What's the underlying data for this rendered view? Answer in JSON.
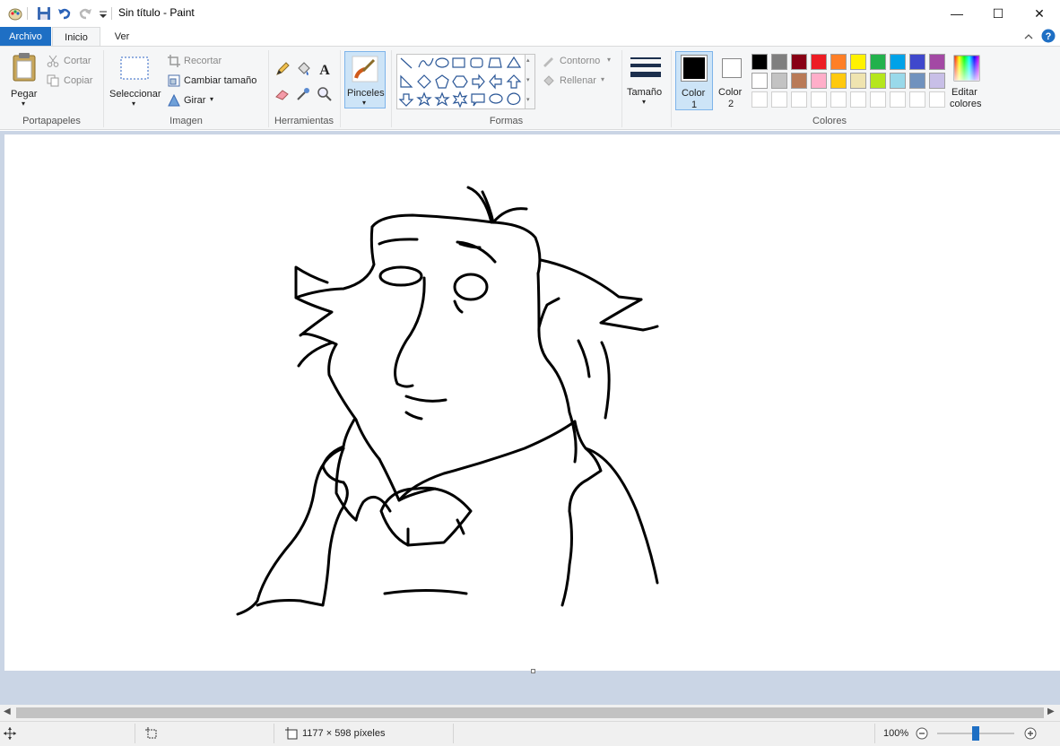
{
  "window": {
    "title": "Sin título - Paint",
    "minimize": "—",
    "maximize": "☐",
    "close": "✕"
  },
  "tabs": {
    "file": "Archivo",
    "home": "Inicio",
    "view": "Ver"
  },
  "ribbon": {
    "clipboard": {
      "label": "Portapapeles",
      "paste": "Pegar",
      "cut": "Cortar",
      "copy": "Copiar"
    },
    "image": {
      "label": "Imagen",
      "select": "Seleccionar",
      "crop": "Recortar",
      "resize": "Cambiar tamaño",
      "rotate": "Girar"
    },
    "tools": {
      "label": "Herramientas"
    },
    "brushes": {
      "label": "Pinceles"
    },
    "shapes": {
      "label": "Formas",
      "outline": "Contorno",
      "fill": "Rellenar"
    },
    "size": {
      "label": "Tamaño"
    },
    "colors": {
      "label": "Colores",
      "color1": "Color",
      "color1_num": "1",
      "color2": "Color",
      "color2_num": "2",
      "edit": "Editar",
      "edit2": "colores",
      "color1_value": "#000000",
      "color2_value": "#ffffff",
      "palette_row1": [
        "#000000",
        "#7f7f7f",
        "#880015",
        "#ed1c24",
        "#ff7f27",
        "#fff200",
        "#22b14c",
        "#00a2e8",
        "#3f48cc",
        "#a349a4"
      ],
      "palette_row2": [
        "#ffffff",
        "#c3c3c3",
        "#b97a57",
        "#ffaec9",
        "#ffc90e",
        "#efe4b0",
        "#b5e61d",
        "#99d9ea",
        "#7092be",
        "#c8bfe7"
      ]
    }
  },
  "status": {
    "canvas_size": "1177 × 598 píxeles",
    "zoom": "100%"
  }
}
